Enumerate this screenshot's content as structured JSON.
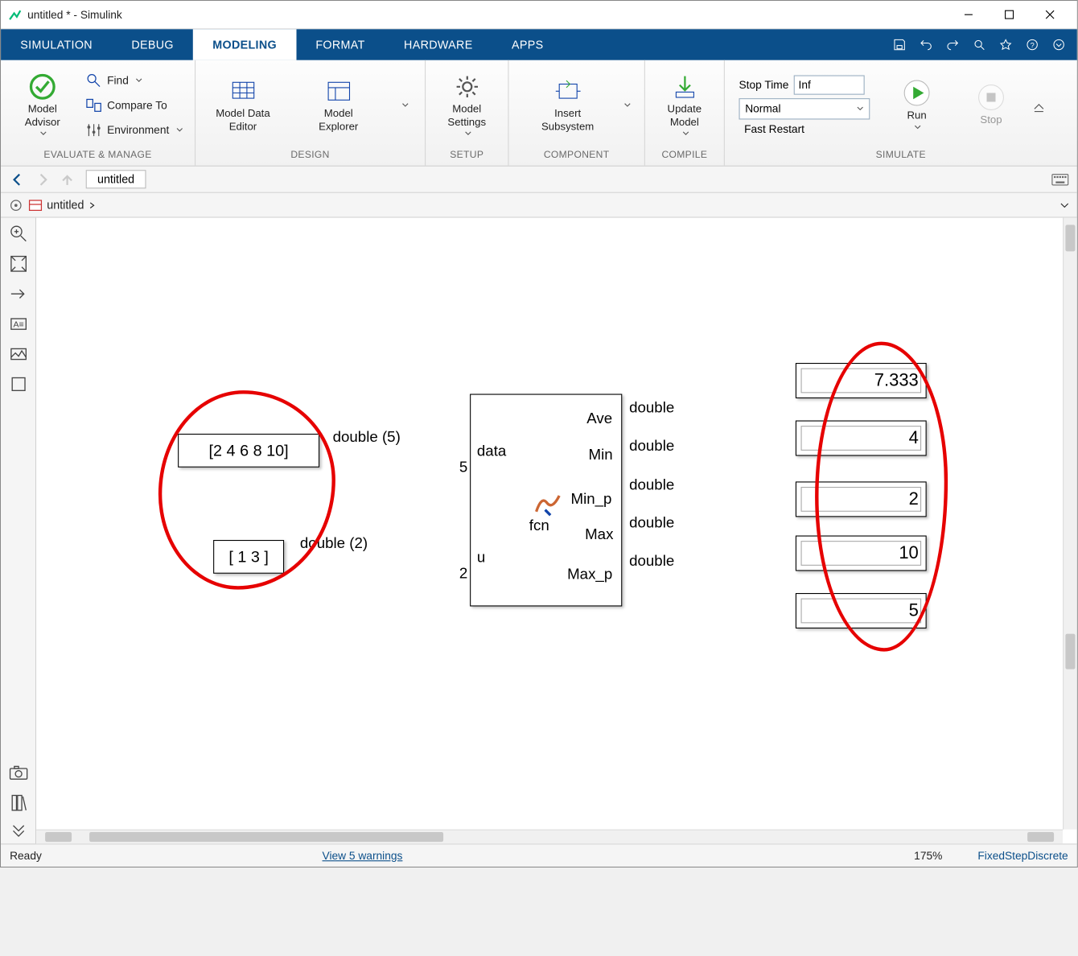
{
  "window": {
    "title": "untitled * - Simulink"
  },
  "tabs": [
    "SIMULATION",
    "DEBUG",
    "MODELING",
    "FORMAT",
    "HARDWARE",
    "APPS"
  ],
  "active_tab": "MODELING",
  "toolstrip": {
    "evaluate": {
      "advisor": "Model\nAdvisor",
      "find": "Find",
      "compare": "Compare To",
      "env": "Environment",
      "label": "EVALUATE & MANAGE"
    },
    "design": {
      "mde": "Model Data\nEditor",
      "mex": "Model\nExplorer",
      "label": "DESIGN"
    },
    "setup": {
      "settings": "Model\nSettings",
      "label": "SETUP"
    },
    "component": {
      "insert": "Insert\nSubsystem",
      "label": "COMPONENT"
    },
    "compile": {
      "update": "Update\nModel",
      "label": "COMPILE"
    },
    "simulate": {
      "stoptime_lbl": "Stop Time",
      "stoptime_val": "Inf",
      "mode": "Normal",
      "fast": "Fast Restart",
      "run": "Run",
      "stop": "Stop",
      "label": "SIMULATE"
    }
  },
  "breadcrumb": "untitled",
  "explorer_path": "untitled",
  "diagram": {
    "const1": "[2 4 6 8 10]",
    "const2": "[ 1  3 ]",
    "sig1": "double (5)",
    "sig2": "double (2)",
    "fcn_inputs": [
      {
        "name": "data",
        "dim": "5"
      },
      {
        "name": "u",
        "dim": "2"
      }
    ],
    "fcn_outputs": [
      "Ave",
      "Min",
      "Min_p",
      "Max",
      "Max_p"
    ],
    "fcn_label": "fcn",
    "out_types": [
      "double",
      "double",
      "double",
      "double",
      "double"
    ],
    "displays": [
      "7.333",
      "4",
      "2",
      "10",
      "5"
    ]
  },
  "status": {
    "ready": "Ready",
    "warnings": "View 5 warnings",
    "zoom": "175%",
    "solver": "FixedStepDiscrete"
  }
}
